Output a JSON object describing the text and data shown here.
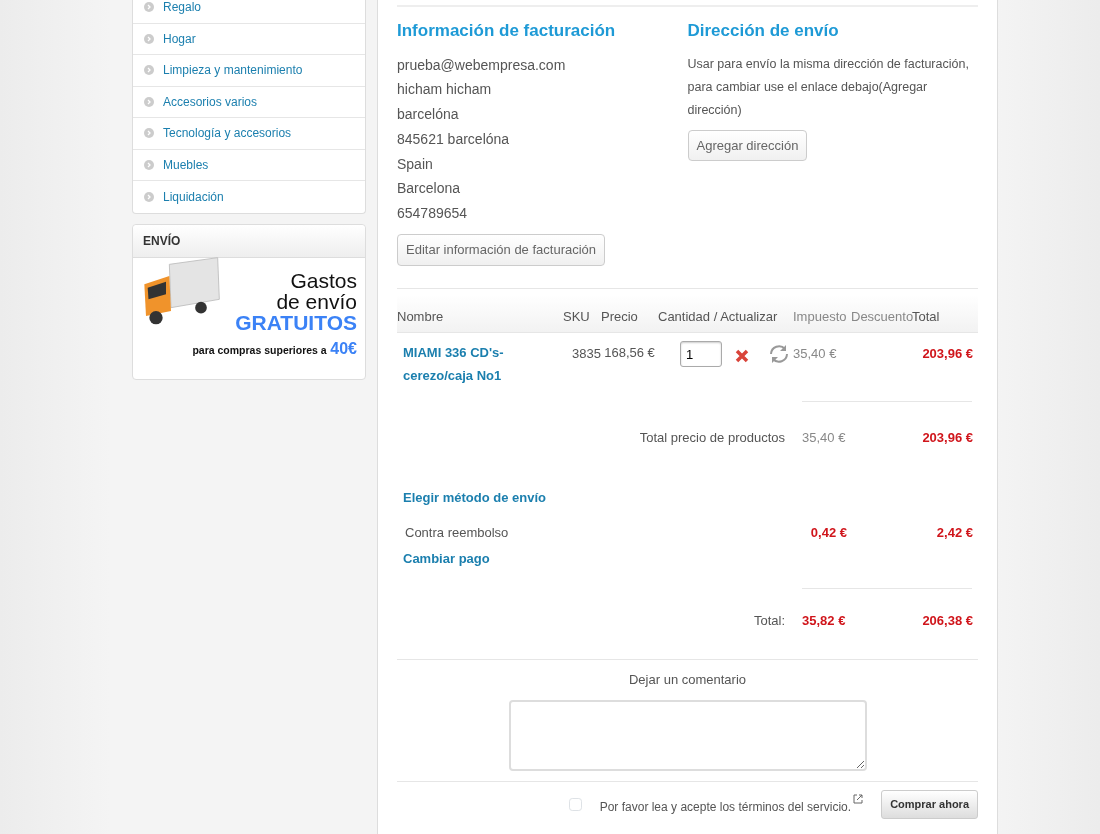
{
  "sidebar": {
    "categories": [
      {
        "label": "Regalo"
      },
      {
        "label": "Hogar"
      },
      {
        "label": "Limpieza y mantenimiento"
      },
      {
        "label": "Accesorios varios"
      },
      {
        "label": "Tecnología y accesorios"
      },
      {
        "label": "Muebles"
      },
      {
        "label": "Liquidación"
      }
    ],
    "shipping_box": {
      "title": "ENVÍO",
      "banner": {
        "line_1": "Gastos",
        "line_2": "de envío",
        "highlight": "GRATUITOS",
        "footnote": "para compras superiores a",
        "amount": "40€"
      }
    }
  },
  "billing": {
    "title": "Información de facturación",
    "lines": [
      "prueba@webempresa.com",
      "hicham hicham",
      "barcelóna",
      "845621 barcelóna",
      "Spain",
      "Barcelona",
      "654789654"
    ],
    "edit_button": "Editar información de facturación"
  },
  "shipping_address": {
    "title": "Dirección de envío",
    "text": "Usar para envío la misma dirección de facturación, para cambiar use el enlace debajo(Agregar dirección)",
    "button": "Agregar dirección"
  },
  "cart": {
    "columns": [
      "Nombre",
      "SKU",
      "Precio",
      "Cantidad / Actualizar",
      "Impuesto",
      "Descuento",
      "Total"
    ],
    "items": [
      {
        "name": "MIAMI 336 CD's-cerezo/caja No1",
        "sku": "3835",
        "price": "168,56 €",
        "quantity": "1",
        "tax": "35,40 €",
        "total": "203,96 €"
      }
    ],
    "subtotal": {
      "label": "Total precio de productos",
      "tax": "35,40 €",
      "total": "203,96 €"
    },
    "shipping_link": "Elegir método de envío",
    "payment": {
      "name": "Contra reembolso",
      "tax": "0,42 €",
      "total": "2,42 €",
      "link": "Cambiar pago"
    },
    "grand_total": {
      "label": "Total:",
      "tax": "35,82 €",
      "total": "206,38 €"
    }
  },
  "comment": {
    "label": "Dejar un comentario"
  },
  "terms": {
    "text": "Por favor lea y acepte los términos del servicio.",
    "checked": false
  },
  "submit_button": "Comprar ahora"
}
